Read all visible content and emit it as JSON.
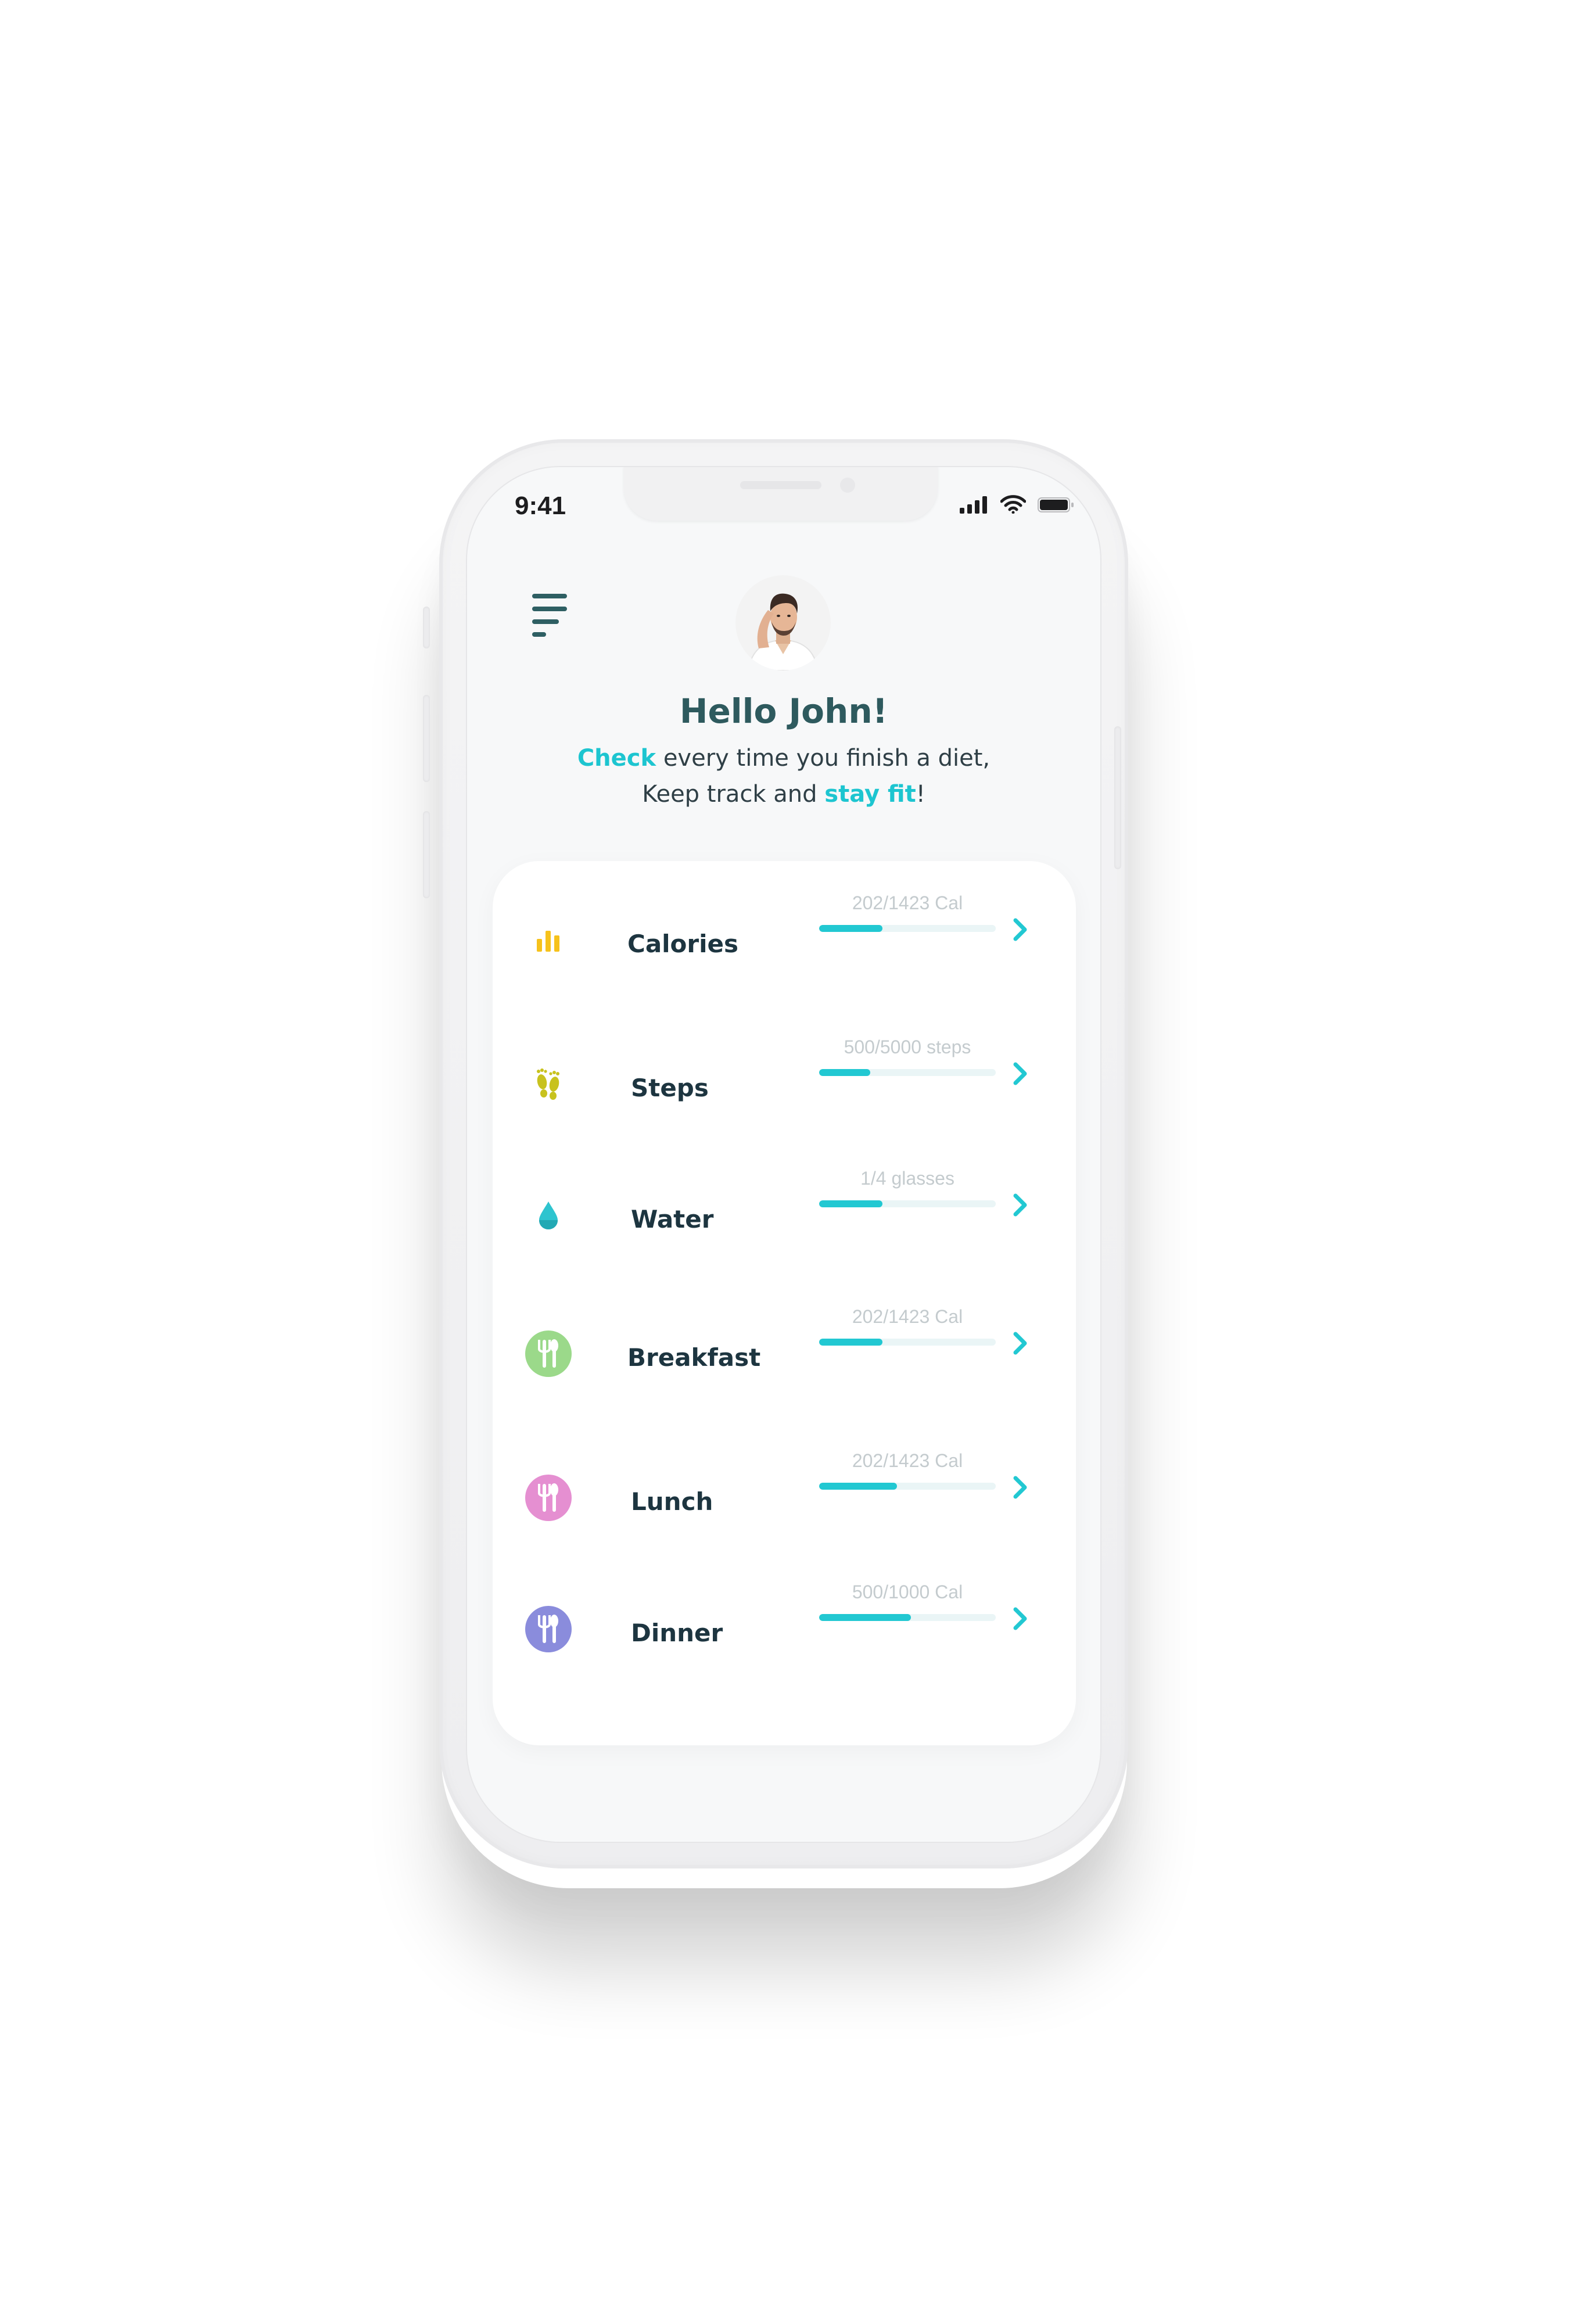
{
  "status_bar": {
    "time": "9:41"
  },
  "header": {
    "menu_icon": "menu-icon",
    "avatar_icon": "avatar",
    "greeting": "Hello John!",
    "subtitle_line1_accent": "Check",
    "subtitle_line1_rest": " every time you finish a diet,",
    "subtitle_line2_pre": "Keep track and ",
    "subtitle_line2_accent": "stay fit",
    "subtitle_line2_post": "!"
  },
  "colors": {
    "accent": "#1dc5d0",
    "progress": "#22c8d2",
    "heading": "#2e5a5e",
    "calories_icon": "#f6c21c",
    "steps_icon": "#c8c21e",
    "water_icon": "#2ec4cf",
    "breakfast_icon": "#9bd98a",
    "lunch_icon": "#e58fd1",
    "dinner_icon": "#8a8cdc"
  },
  "trackers": [
    {
      "label": "Calories",
      "value_text": "202/1423 Cal",
      "progress": 0.36,
      "icon": "bar-chart-icon"
    },
    {
      "label": "Steps",
      "value_text": "500/5000 steps",
      "progress": 0.29,
      "icon": "footprints-icon"
    },
    {
      "label": "Water",
      "value_text": "1/4 glasses",
      "progress": 0.36,
      "icon": "water-drop-icon"
    },
    {
      "label": "Breakfast",
      "value_text": "202/1423 Cal",
      "progress": 0.36,
      "icon": "cutlery-icon"
    },
    {
      "label": "Lunch",
      "value_text": "202/1423 Cal",
      "progress": 0.44,
      "icon": "cutlery-icon"
    },
    {
      "label": "Dinner",
      "value_text": "500/1000 Cal",
      "progress": 0.52,
      "icon": "cutlery-icon"
    }
  ]
}
